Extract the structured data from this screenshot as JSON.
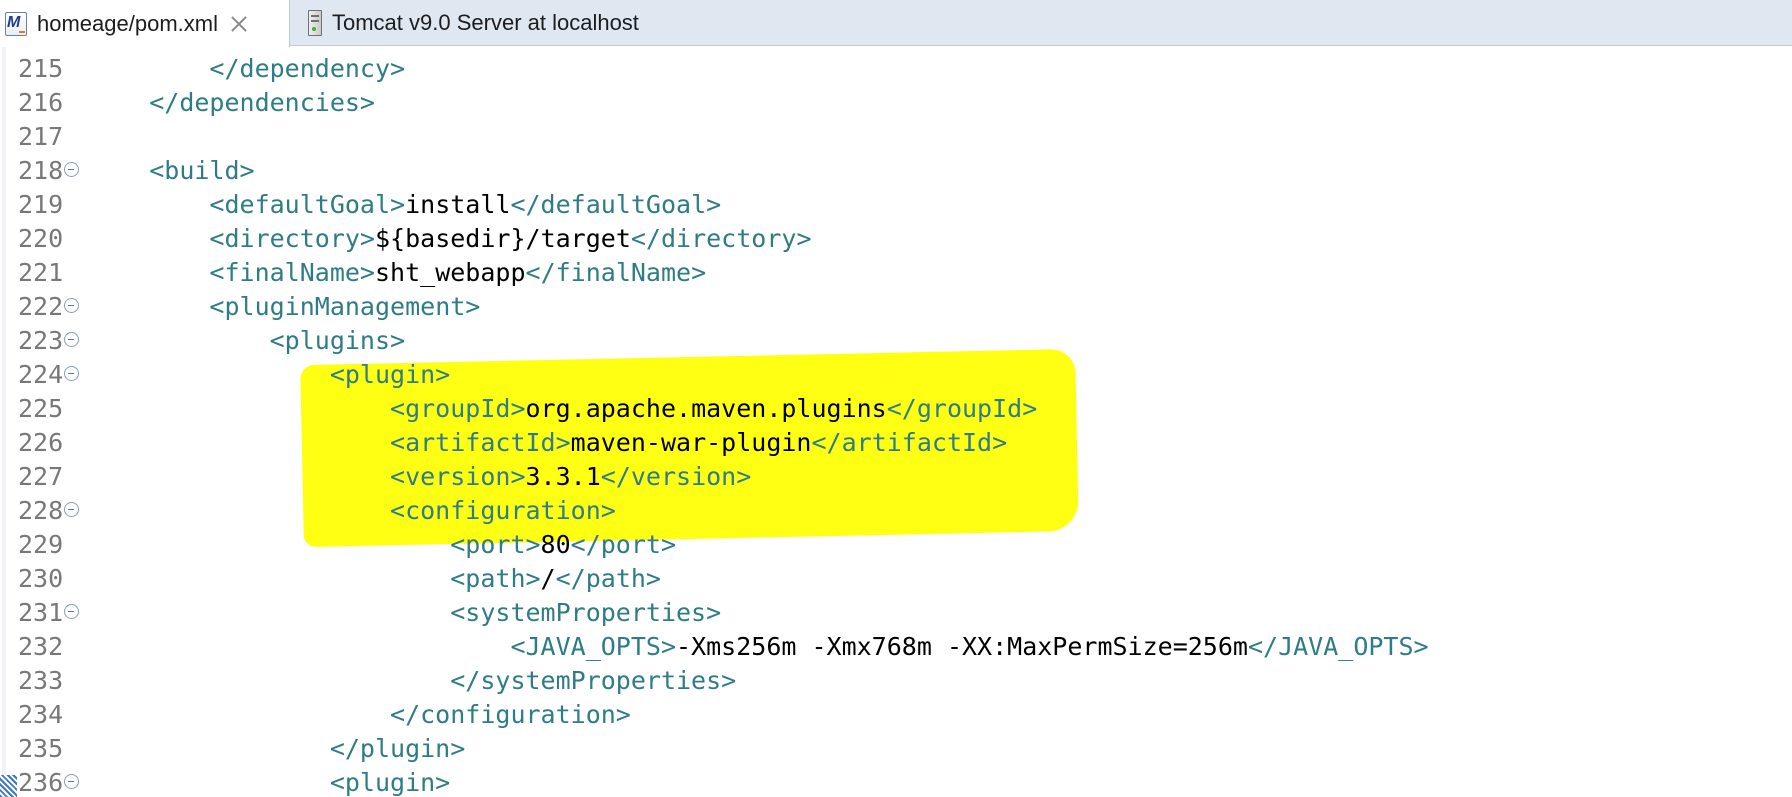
{
  "tabs": [
    {
      "label": "homeage/pom.xml",
      "icon": "maven-pom-icon",
      "active": true,
      "closable": true
    },
    {
      "label": "Tomcat v9.0 Server at localhost",
      "icon": "server-icon",
      "active": false,
      "closable": false
    }
  ],
  "colors": {
    "tag": "#2e7d86",
    "text": "#000000",
    "line_number": "#787878",
    "highlight": "#ffff00",
    "tab_bar": "#dfe7f1"
  },
  "lines": [
    {
      "num": "215",
      "fold": false,
      "indent": "        ",
      "parts": [
        {
          "t": "tag",
          "v": "</dependency>"
        }
      ]
    },
    {
      "num": "216",
      "fold": false,
      "indent": "    ",
      "parts": [
        {
          "t": "tag",
          "v": "</dependencies>"
        }
      ]
    },
    {
      "num": "217",
      "fold": false,
      "indent": "",
      "parts": []
    },
    {
      "num": "218",
      "fold": true,
      "indent": "    ",
      "parts": [
        {
          "t": "tag",
          "v": "<build>"
        }
      ]
    },
    {
      "num": "219",
      "fold": false,
      "indent": "        ",
      "parts": [
        {
          "t": "tag",
          "v": "<defaultGoal>"
        },
        {
          "t": "text",
          "v": "install"
        },
        {
          "t": "tag",
          "v": "</defaultGoal>"
        }
      ]
    },
    {
      "num": "220",
      "fold": false,
      "indent": "        ",
      "parts": [
        {
          "t": "tag",
          "v": "<directory>"
        },
        {
          "t": "text",
          "v": "${basedir}/target"
        },
        {
          "t": "tag",
          "v": "</directory>"
        }
      ]
    },
    {
      "num": "221",
      "fold": false,
      "indent": "        ",
      "parts": [
        {
          "t": "tag",
          "v": "<finalName>"
        },
        {
          "t": "text",
          "v": "sht_webapp"
        },
        {
          "t": "tag",
          "v": "</finalName>"
        }
      ]
    },
    {
      "num": "222",
      "fold": true,
      "indent": "        ",
      "parts": [
        {
          "t": "tag",
          "v": "<pluginManagement>"
        }
      ]
    },
    {
      "num": "223",
      "fold": true,
      "indent": "            ",
      "parts": [
        {
          "t": "tag",
          "v": "<plugins>"
        }
      ]
    },
    {
      "num": "224",
      "fold": true,
      "indent": "                ",
      "parts": [
        {
          "t": "tag",
          "v": "<plugin>"
        }
      ]
    },
    {
      "num": "225",
      "fold": false,
      "indent": "                    ",
      "parts": [
        {
          "t": "tag",
          "v": "<groupId>"
        },
        {
          "t": "text",
          "v": "org.apache.maven.plugins"
        },
        {
          "t": "tag",
          "v": "</groupId>"
        }
      ]
    },
    {
      "num": "226",
      "fold": false,
      "indent": "                    ",
      "parts": [
        {
          "t": "tag",
          "v": "<artifactId>"
        },
        {
          "t": "text",
          "v": "maven-war-plugin"
        },
        {
          "t": "tag",
          "v": "</artifactId>"
        }
      ]
    },
    {
      "num": "227",
      "fold": false,
      "indent": "                    ",
      "parts": [
        {
          "t": "tag",
          "v": "<version>"
        },
        {
          "t": "text",
          "v": "3.3.1"
        },
        {
          "t": "tag",
          "v": "</version>"
        }
      ]
    },
    {
      "num": "228",
      "fold": true,
      "indent": "                    ",
      "parts": [
        {
          "t": "tag",
          "v": "<configuration>"
        }
      ]
    },
    {
      "num": "229",
      "fold": false,
      "indent": "                        ",
      "parts": [
        {
          "t": "tag",
          "v": "<port>"
        },
        {
          "t": "text",
          "v": "80"
        },
        {
          "t": "tag",
          "v": "</port>"
        }
      ]
    },
    {
      "num": "230",
      "fold": false,
      "indent": "                        ",
      "parts": [
        {
          "t": "tag",
          "v": "<path>"
        },
        {
          "t": "text",
          "v": "/"
        },
        {
          "t": "tag",
          "v": "</path>"
        }
      ]
    },
    {
      "num": "231",
      "fold": true,
      "indent": "                        ",
      "parts": [
        {
          "t": "tag",
          "v": "<systemProperties>"
        }
      ]
    },
    {
      "num": "232",
      "fold": false,
      "indent": "                            ",
      "parts": [
        {
          "t": "tag",
          "v": "<JAVA_OPTS>"
        },
        {
          "t": "text",
          "v": "-Xms256m -Xmx768m -XX:MaxPermSize=256m"
        },
        {
          "t": "tag",
          "v": "</JAVA_OPTS>"
        }
      ]
    },
    {
      "num": "233",
      "fold": false,
      "indent": "                        ",
      "parts": [
        {
          "t": "tag",
          "v": "</systemProperties>"
        }
      ]
    },
    {
      "num": "234",
      "fold": false,
      "indent": "                    ",
      "parts": [
        {
          "t": "tag",
          "v": "</configuration>"
        }
      ]
    },
    {
      "num": "235",
      "fold": false,
      "indent": "                ",
      "parts": [
        {
          "t": "tag",
          "v": "</plugin>"
        }
      ]
    },
    {
      "num": "236",
      "fold": true,
      "indent": "                ",
      "parts": [
        {
          "t": "tag",
          "v": "<plugin>"
        }
      ]
    }
  ]
}
